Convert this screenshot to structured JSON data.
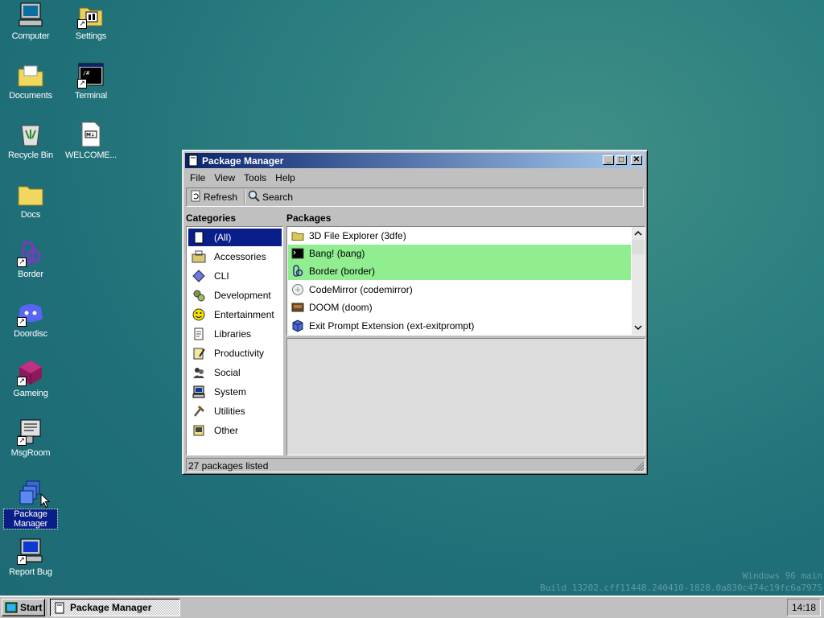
{
  "desktop": {
    "icons": [
      {
        "label": "Computer"
      },
      {
        "label": "Settings"
      },
      {
        "label": "Documents"
      },
      {
        "label": "Terminal"
      },
      {
        "label": "Recycle Bin"
      },
      {
        "label": "WELCOME..."
      },
      {
        "label": "Docs"
      },
      {
        "label": "Border"
      },
      {
        "label": "Doordisc"
      },
      {
        "label": "Gameing"
      },
      {
        "label": "MsgRoom"
      },
      {
        "label": "Package Manager"
      },
      {
        "label": "Report Bug"
      }
    ],
    "welcome_file_glyph": "M↓",
    "terminal_glyph": "/#"
  },
  "window": {
    "title": "Package Manager",
    "controls": {
      "minimize": "_",
      "maximize": "□",
      "close": "✕"
    },
    "menu": [
      "File",
      "View",
      "Tools",
      "Help"
    ],
    "toolbar": {
      "refresh_label": "Refresh",
      "search_label": "Search"
    },
    "categories_heading": "Categories",
    "packages_heading": "Packages",
    "categories": [
      {
        "label": "(All)",
        "icon": "all-packages-icon",
        "active": true
      },
      {
        "label": "Accessories",
        "icon": "accessories-icon"
      },
      {
        "label": "CLI",
        "icon": "cli-icon"
      },
      {
        "label": "Development",
        "icon": "development-icon"
      },
      {
        "label": "Entertainment",
        "icon": "entertainment-icon"
      },
      {
        "label": "Libraries",
        "icon": "libraries-icon"
      },
      {
        "label": "Productivity",
        "icon": "productivity-icon"
      },
      {
        "label": "Social",
        "icon": "social-icon"
      },
      {
        "label": "System",
        "icon": "system-icon"
      },
      {
        "label": "Utilities",
        "icon": "utilities-icon"
      },
      {
        "label": "Other",
        "icon": "other-icon"
      }
    ],
    "packages": [
      {
        "label": "3D File Explorer (3dfe)",
        "icon": "folder-icon",
        "highlighted": false
      },
      {
        "label": "Bang! (bang)",
        "icon": "terminal-icon",
        "highlighted": true
      },
      {
        "label": "Border (border)",
        "icon": "border-icon",
        "highlighted": true
      },
      {
        "label": "CodeMirror (codemirror)",
        "icon": "codemirror-icon",
        "highlighted": false
      },
      {
        "label": "DOOM (doom)",
        "icon": "doom-icon",
        "highlighted": false
      },
      {
        "label": "Exit Prompt Extension (ext-exitprompt)",
        "icon": "package-icon",
        "highlighted": false
      }
    ],
    "status_text": "27 packages listed",
    "highlight_color": "#90ee90",
    "selection_color": "#0a1e8a"
  },
  "taskbar": {
    "start_label": "Start",
    "task_label": "Package Manager",
    "clock": "14:18"
  },
  "watermark": {
    "line1": "Windows 96 main",
    "line2": "Build 13202.cff11448.240410-1828.0a830c474c19fc6a7975"
  }
}
